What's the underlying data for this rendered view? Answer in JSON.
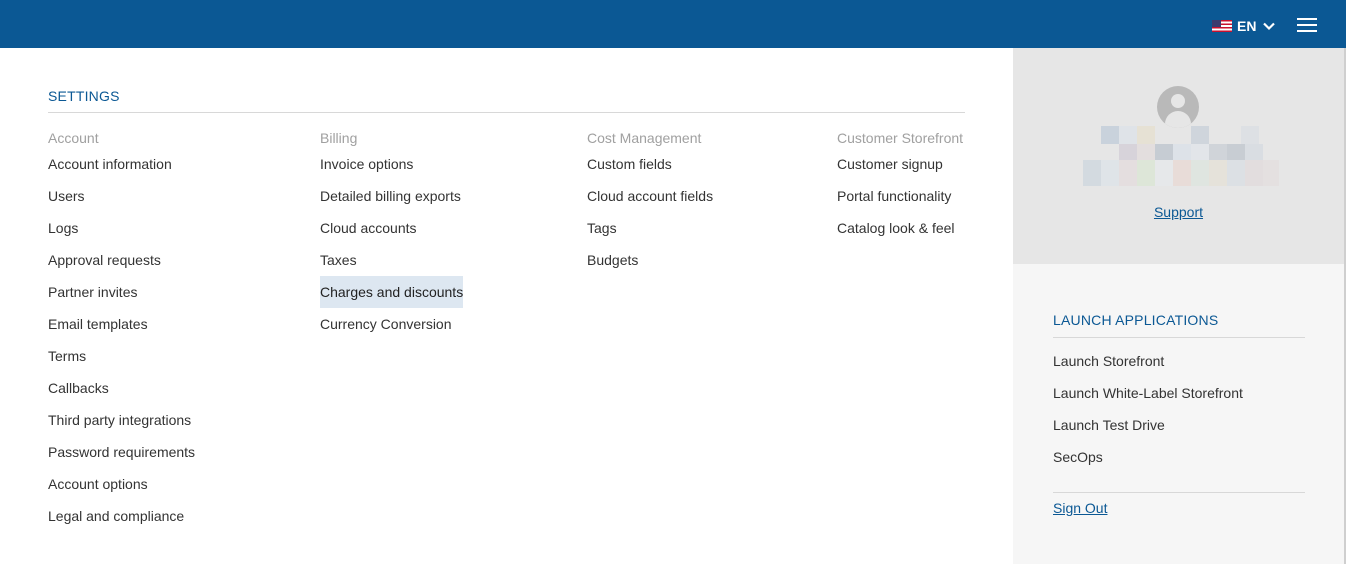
{
  "header": {
    "language": "EN",
    "language_flag_icon": "us-flag-icon",
    "menu_icon": "hamburger-menu-icon",
    "bar_color": "#0b5894"
  },
  "settings": {
    "title": "SETTINGS",
    "columns": [
      {
        "heading": "Account",
        "items": [
          "Account information",
          "Users",
          "Logs",
          "Approval requests",
          "Partner invites",
          "Email templates",
          "Terms",
          "Callbacks",
          "Third party integrations",
          "Password requirements",
          "Account options",
          "Legal and compliance"
        ]
      },
      {
        "heading": "Billing",
        "items": [
          "Invoice options",
          "Detailed billing exports",
          "Cloud accounts",
          "Taxes",
          "Charges and discounts",
          "Currency Conversion"
        ]
      },
      {
        "heading": "Cost Management",
        "items": [
          "Custom fields",
          "Cloud account fields",
          "Tags",
          "Budgets"
        ]
      },
      {
        "heading": "Customer Storefront",
        "items": [
          "Customer signup",
          "Portal functionality",
          "Catalog look & feel"
        ]
      }
    ],
    "highlighted_item": "Charges and discounts"
  },
  "profile": {
    "avatar_icon": "user-avatar-icon",
    "support_link": "Support"
  },
  "launch": {
    "title": "LAUNCH APPLICATIONS",
    "items": [
      "Launch Storefront",
      "Launch White-Label Storefront",
      "Launch Test Drive",
      "SecOps"
    ]
  },
  "sign_out": "Sign Out"
}
